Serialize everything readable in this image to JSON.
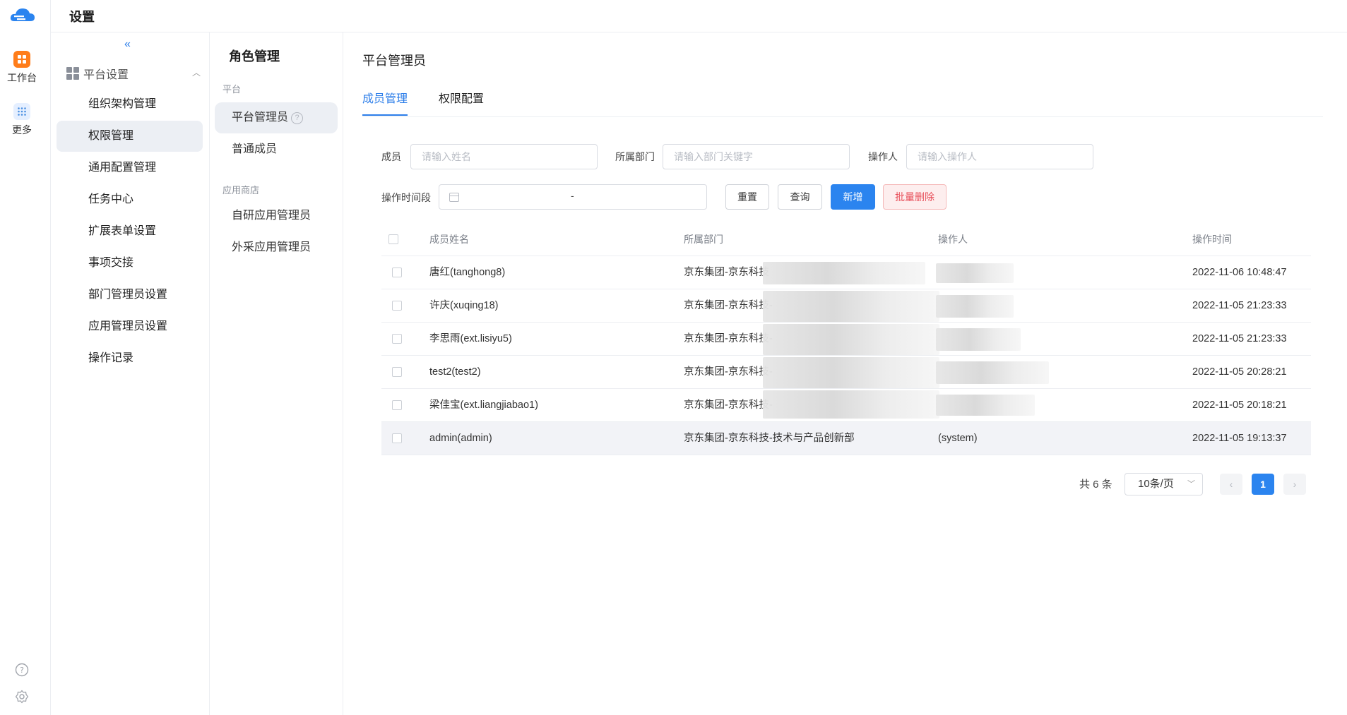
{
  "header": {
    "title": "设置"
  },
  "rail": {
    "items": [
      {
        "label": "工作台",
        "icon": "workbench-icon",
        "color": "#ff7d1a"
      },
      {
        "label": "更多",
        "icon": "more-apps-icon",
        "color": "#4a90e2"
      }
    ],
    "bottom_icons": [
      "help-icon",
      "settings-icon"
    ]
  },
  "settings_nav": {
    "collapse_icon": "«",
    "group_label": "平台设置",
    "items": [
      {
        "label": "组织架构管理",
        "active": false
      },
      {
        "label": "权限管理",
        "active": true
      },
      {
        "label": "通用配置管理",
        "active": false
      },
      {
        "label": "任务中心",
        "active": false
      },
      {
        "label": "扩展表单设置",
        "active": false
      },
      {
        "label": "事项交接",
        "active": false
      },
      {
        "label": "部门管理员设置",
        "active": false
      },
      {
        "label": "应用管理员设置",
        "active": false
      },
      {
        "label": "操作记录",
        "active": false
      }
    ]
  },
  "role_nav": {
    "heading": "角色管理",
    "section_platform": "平台",
    "item_platform_admin": "平台管理员",
    "item_member": "普通成员",
    "section_store": "应用商店",
    "item_self_app_admin": "自研应用管理员",
    "item_purchased_app_admin": "外采应用管理员",
    "help_glyph": "?"
  },
  "main": {
    "title": "平台管理员",
    "tabs": [
      {
        "label": "成员管理",
        "active": true
      },
      {
        "label": "权限配置",
        "active": false
      }
    ],
    "filters": {
      "member_label": "成员",
      "member_placeholder": "请输入姓名",
      "dept_label": "所属部门",
      "dept_placeholder": "请输入部门关键字",
      "operator_label": "操作人",
      "operator_placeholder": "请输入操作人",
      "time_label": "操作时间段",
      "time_separator": "-"
    },
    "buttons": {
      "reset": "重置",
      "query": "查询",
      "add": "新增",
      "batch_delete": "批量删除"
    },
    "table": {
      "columns": [
        "成员姓名",
        "所属部门",
        "操作人",
        "操作时间"
      ],
      "rows": [
        {
          "name": "唐红(tanghong8)",
          "dept": "京东集团-京东科技",
          "operator": "",
          "time": "2022-11-06 10:48:47",
          "blurred": true
        },
        {
          "name": "许庆(xuqing18)",
          "dept": "京东集团-京东科技-",
          "operator": "",
          "time": "2022-11-05 21:23:33",
          "blurred": true
        },
        {
          "name": "李思雨(ext.lisiyu5)",
          "dept": "京东集团-京东科技-",
          "operator": "",
          "time": "2022-11-05 21:23:33",
          "blurred": true
        },
        {
          "name": "test2(test2)",
          "dept": "京东集团-京东科技-",
          "operator": "",
          "time": "2022-11-05 20:28:21",
          "blurred": true
        },
        {
          "name": "梁佳宝(ext.liangjiabao1)",
          "dept": "京东集团-京东科技-",
          "operator": "",
          "time": "2022-11-05 20:18:21",
          "blurred": true
        },
        {
          "name": "admin(admin)",
          "dept": "京东集团-京东科技-技术与产品创新部",
          "operator": "(system)",
          "time": "2022-11-05 19:13:37",
          "blurred": false
        }
      ]
    },
    "pagination": {
      "total": "共 6 条",
      "page_size": "10条/页",
      "current_page": "1",
      "prev": "‹",
      "next": "›"
    }
  },
  "colors": {
    "primary": "#2b84ef",
    "danger": "#e8505b",
    "active_bg": "#eceff4"
  }
}
